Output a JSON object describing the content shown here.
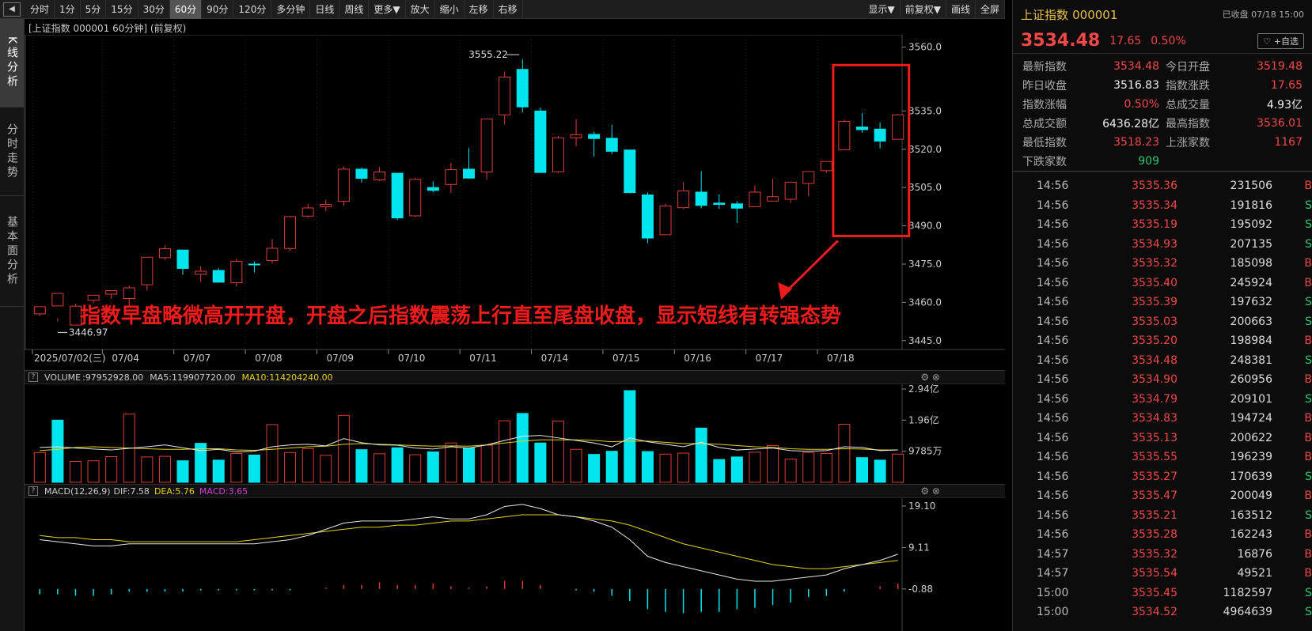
{
  "toolbar": {
    "items": [
      "分时",
      "1分",
      "5分",
      "15分",
      "30分",
      "60分",
      "90分",
      "120分",
      "多分钟",
      "日线",
      "周线",
      "更多▼",
      "放大",
      "缩小",
      "左移",
      "右移"
    ],
    "active": "60分",
    "right": [
      "显示▼",
      "前复权▼",
      "画线",
      "全屏"
    ]
  },
  "left_tabs": [
    "K线分析",
    "分时走势",
    "基本面分析"
  ],
  "chart_title": "[上证指数 000001 60分钟]  (前复权)",
  "annotation": "指数早盘略微高开开盘，开盘之后指数震荡上行直至尾盘收盘，显示短线有转强态势",
  "markers": {
    "high": "3555.22",
    "low": "3446.97"
  },
  "volume_header": {
    "label": "VOLUME",
    "value": ":97952928.00",
    "ma5": "MA5:119907720.00",
    "ma10": "MA10:114204240.00"
  },
  "macd_header": {
    "label": "MACD(12,26,9)",
    "dif": "DIF:7.58",
    "dea": "DEA:5.76",
    "macd": "MACD:3.65"
  },
  "colors": {
    "up": "#e03a3a",
    "down": "#00e5ee",
    "ma5": "#e6e6e6",
    "ma10": "#e6d219",
    "macd_label": "#d63ed6"
  },
  "chart_data": [
    {
      "type": "candlestick",
      "y_ticks": [
        "3560.0",
        "3535.0",
        "3520.0",
        "3505.0",
        "3490.0",
        "3475.0",
        "3460.0",
        "3445.0"
      ],
      "ylim": [
        3444,
        3563
      ],
      "x_labels": [
        "2025/07/02(三)",
        "07/04",
        "07/07",
        "07/08",
        "07/09",
        "07/10",
        "07/11",
        "07/14",
        "07/15",
        "07/16",
        "07/17",
        "07/18"
      ],
      "candles": [
        [
          3455.5,
          3458.3,
          3457.9,
          3454.6
        ],
        [
          3458.6,
          3463.5,
          3453.8,
          3452.5
        ],
        [
          3451.1,
          3458.5,
          3459.5,
          3451.1
        ],
        [
          3460.8,
          3462.8,
          3460.6,
          3459.7
        ],
        [
          3463.2,
          3464.6,
          3463.3,
          3461.4
        ],
        [
          3461.5,
          3465.7,
          3466.5,
          3458.5
        ],
        [
          3466.9,
          3477.7,
          3477.7,
          3464.6
        ],
        [
          3477.5,
          3481.0,
          3482.4,
          3476.6
        ],
        [
          3480.5,
          3473.3,
          3477.4,
          3470.8
        ],
        [
          3471.0,
          3472.2,
          3474.2,
          3468.0
        ],
        [
          3472.5,
          3467.9,
          3473.4,
          3467.7
        ],
        [
          3467.7,
          3476.1,
          3477.0,
          3466.3
        ],
        [
          3475.0,
          3474.7,
          3476.1,
          3471.7
        ],
        [
          3476.4,
          3481.2,
          3484.8,
          3475.2
        ],
        [
          3481.1,
          3493.6,
          3494.0,
          3480.2
        ],
        [
          3493.8,
          3497.0,
          3498.6,
          3493.1
        ],
        [
          3497.5,
          3498.4,
          3500.2,
          3495.7
        ],
        [
          3499.6,
          3512.2,
          3513.2,
          3497.8
        ],
        [
          3512.2,
          3508.6,
          3512.9,
          3506.9
        ],
        [
          3508.0,
          3511.1,
          3513.0,
          3507.5
        ],
        [
          3510.6,
          3493.1,
          3510.0,
          3492.2
        ],
        [
          3493.9,
          3508.2,
          3508.8,
          3493.4
        ],
        [
          3505.0,
          3503.9,
          3507.4,
          3503.1
        ],
        [
          3506.2,
          3512.0,
          3514.6,
          3502.9
        ],
        [
          3512.2,
          3508.7,
          3520.5,
          3508.4
        ],
        [
          3511.1,
          3531.9,
          3531.7,
          3508.0
        ],
        [
          3533.5,
          3548.3,
          3550.4,
          3529.7
        ],
        [
          3551.3,
          3536.6,
          3555.2,
          3534.4
        ],
        [
          3535.0,
          3510.9,
          3536.4,
          3510.9
        ],
        [
          3511.2,
          3524.5,
          3525.2,
          3510.7
        ],
        [
          3524.5,
          3525.7,
          3531.8,
          3521.2
        ],
        [
          3525.8,
          3524.2,
          3526.9,
          3517.2
        ],
        [
          3524.3,
          3519.2,
          3529.6,
          3518.1
        ],
        [
          3519.7,
          3503.0,
          3518.3,
          3502.8
        ],
        [
          3502.1,
          3485.2,
          3503.1,
          3483.2
        ],
        [
          3486.5,
          3497.8,
          3498.7,
          3486.6
        ],
        [
          3497.1,
          3503.7,
          3507.2,
          3496.6
        ],
        [
          3503.2,
          3498.0,
          3511.4,
          3496.9
        ],
        [
          3498.9,
          3498.4,
          3502.3,
          3496.6
        ],
        [
          3498.6,
          3496.9,
          3499.6,
          3491.2
        ],
        [
          3497.5,
          3503.2,
          3505.9,
          3497.4
        ],
        [
          3499.7,
          3501.4,
          3508.4,
          3501.4
        ],
        [
          3500.4,
          3507.1,
          3507.1,
          3499.0
        ],
        [
          3506.6,
          3511.3,
          3511.2,
          3501.5
        ],
        [
          3511.6,
          3515.2,
          3513.0,
          3510.8
        ],
        [
          3519.8,
          3530.9,
          3531.6,
          3520.1
        ],
        [
          3528.7,
          3527.7,
          3534.2,
          3526.4
        ],
        [
          3527.9,
          3523.2,
          3530.5,
          3520.3
        ],
        [
          3523.9,
          3533.5,
          3533.8,
          3524.3
        ]
      ],
      "title": "",
      "xlabel": "",
      "ylabel": ""
    },
    {
      "type": "bar",
      "name": "volume",
      "y_ticks": [
        "2.94亿",
        "1.96亿",
        "9785万"
      ],
      "ylim": [
        0,
        294000000
      ],
      "values": [
        94,
        196,
        66,
        68,
        81,
        215,
        80,
        82,
        68,
        123,
        70,
        91,
        86,
        182,
        94,
        106,
        85,
        211,
        103,
        90,
        109,
        87,
        96,
        124,
        108,
        117,
        194,
        217,
        124,
        193,
        104,
        88,
        98,
        289,
        97,
        89,
        92,
        171,
        72,
        80,
        95,
        116,
        73,
        94,
        91,
        183,
        78,
        70,
        89
      ],
      "colors_up": [
        1,
        0,
        1,
        1,
        1,
        1,
        1,
        1,
        0,
        0,
        0,
        1,
        0,
        1,
        1,
        1,
        1,
        1,
        0,
        1,
        0,
        1,
        0,
        1,
        0,
        1,
        1,
        0,
        0,
        1,
        1,
        0,
        0,
        0,
        0,
        1,
        1,
        0,
        0,
        0,
        1,
        1,
        1,
        1,
        1,
        1,
        0,
        0,
        1
      ],
      "ma5": [
        110,
        112,
        108,
        105,
        102,
        107,
        112,
        118,
        109,
        100,
        104,
        96,
        98,
        112,
        118,
        120,
        115,
        138,
        125,
        118,
        117,
        108,
        105,
        112,
        108,
        118,
        132,
        145,
        148,
        140,
        132,
        124,
        112,
        140,
        128,
        120,
        112,
        126,
        110,
        102,
        105,
        108,
        100,
        98,
        100,
        112,
        110,
        100,
        102
      ],
      "ma10": [
        100,
        104,
        110,
        112,
        110,
        108,
        106,
        104,
        104,
        106,
        106,
        102,
        101,
        104,
        108,
        112,
        114,
        120,
        122,
        120,
        118,
        116,
        114,
        115,
        114,
        118,
        124,
        130,
        134,
        134,
        134,
        132,
        128,
        130,
        130,
        126,
        122,
        122,
        120,
        116,
        112,
        110,
        106,
        104,
        104,
        106,
        105,
        102,
        102
      ]
    },
    {
      "type": "bar",
      "name": "macd",
      "y_ticks": [
        "19.10",
        "9.11",
        "-0.88"
      ],
      "ylim": [
        -11,
        21
      ],
      "dif": [
        11,
        10.5,
        10,
        9.5,
        9.5,
        10,
        10,
        10,
        10,
        10,
        10,
        10,
        10,
        10.5,
        11,
        12,
        13.5,
        15,
        15.5,
        15.5,
        15.5,
        16,
        16.5,
        16,
        16,
        17,
        19,
        19.5,
        18.5,
        17,
        16.5,
        15.5,
        14,
        11,
        7,
        5.5,
        4.5,
        3.5,
        2.5,
        1.5,
        1,
        1,
        1.5,
        2,
        2.5,
        4,
        5,
        6,
        7.5
      ],
      "dea": [
        12,
        11.5,
        11.5,
        11,
        11,
        10.5,
        10.5,
        10.5,
        10.5,
        10.5,
        10.5,
        10.5,
        11,
        11.5,
        12,
        12.5,
        13,
        13.5,
        14,
        14,
        14.5,
        14.5,
        15,
        15.5,
        15.5,
        16,
        16.5,
        17,
        17,
        17,
        16.5,
        16,
        15.5,
        14.5,
        13,
        11.5,
        10,
        9,
        8,
        7,
        6,
        5,
        4.5,
        4,
        4,
        4.5,
        5,
        5.5,
        6
      ],
      "hist": [
        -2,
        -2,
        -2.5,
        -2.5,
        -2,
        -1,
        -1,
        -1,
        -1,
        -0.5,
        -0.5,
        -0.5,
        -0.5,
        -0.5,
        -0.5,
        0,
        0.5,
        1.5,
        1.5,
        2.5,
        1.5,
        1.5,
        2,
        1,
        0.5,
        1,
        3,
        3,
        1.5,
        0,
        -0.5,
        -1,
        -2.5,
        -4.5,
        -7.5,
        -8.5,
        -9,
        -8.5,
        -8.5,
        -7.5,
        -7,
        -6,
        -5,
        -3,
        -2.5,
        -1,
        0,
        1,
        2
      ]
    }
  ],
  "quote": {
    "name": "上证指数",
    "code": "000001",
    "status": "已收盘 07/18 15:00",
    "price": "3534.48",
    "change": "17.65",
    "pct": "0.50%",
    "fav": "♡ +自选",
    "stats": [
      [
        "最新指数",
        "3534.48",
        "red"
      ],
      [
        "今日开盘",
        "3519.48",
        "red"
      ],
      [
        "昨日收盘",
        "3516.83",
        "white"
      ],
      [
        "指数涨跌",
        "17.65",
        "red"
      ],
      [
        "指数涨幅",
        "0.50%",
        "red"
      ],
      [
        "总成交量",
        "4.93亿",
        "white"
      ],
      [
        "总成交额",
        "6436.28亿",
        "white"
      ],
      [
        "最高指数",
        "3536.01",
        "red"
      ],
      [
        "最低指数",
        "3518.23",
        "red"
      ],
      [
        "上涨家数",
        "1167",
        "red"
      ],
      [
        "下跌家数",
        "909",
        "green"
      ]
    ],
    "trades": [
      [
        "14:56",
        "3535.36",
        "231506",
        "B"
      ],
      [
        "14:56",
        "3535.34",
        "191816",
        "S"
      ],
      [
        "14:56",
        "3535.19",
        "195092",
        "S"
      ],
      [
        "14:56",
        "3534.93",
        "207135",
        "S"
      ],
      [
        "14:56",
        "3535.32",
        "185098",
        "B"
      ],
      [
        "14:56",
        "3535.40",
        "245924",
        "B"
      ],
      [
        "14:56",
        "3535.39",
        "197632",
        "S"
      ],
      [
        "14:56",
        "3535.03",
        "200663",
        "S"
      ],
      [
        "14:56",
        "3535.20",
        "198984",
        "B"
      ],
      [
        "14:56",
        "3534.48",
        "248381",
        "S"
      ],
      [
        "14:56",
        "3534.90",
        "260956",
        "B"
      ],
      [
        "14:56",
        "3534.79",
        "209101",
        "S"
      ],
      [
        "14:56",
        "3534.83",
        "194724",
        "B"
      ],
      [
        "14:56",
        "3535.13",
        "200622",
        "B"
      ],
      [
        "14:56",
        "3535.55",
        "196239",
        "B"
      ],
      [
        "14:56",
        "3535.27",
        "170639",
        "S"
      ],
      [
        "14:56",
        "3535.47",
        "200049",
        "B"
      ],
      [
        "14:56",
        "3535.21",
        "163512",
        "S"
      ],
      [
        "14:56",
        "3535.28",
        "162243",
        "B"
      ],
      [
        "14:57",
        "3535.32",
        "16876",
        "B"
      ],
      [
        "14:57",
        "3535.54",
        "49521",
        "B"
      ],
      [
        "15:00",
        "3535.45",
        "1182597",
        "S"
      ],
      [
        "15:00",
        "3534.52",
        "4964639",
        "S"
      ]
    ]
  }
}
